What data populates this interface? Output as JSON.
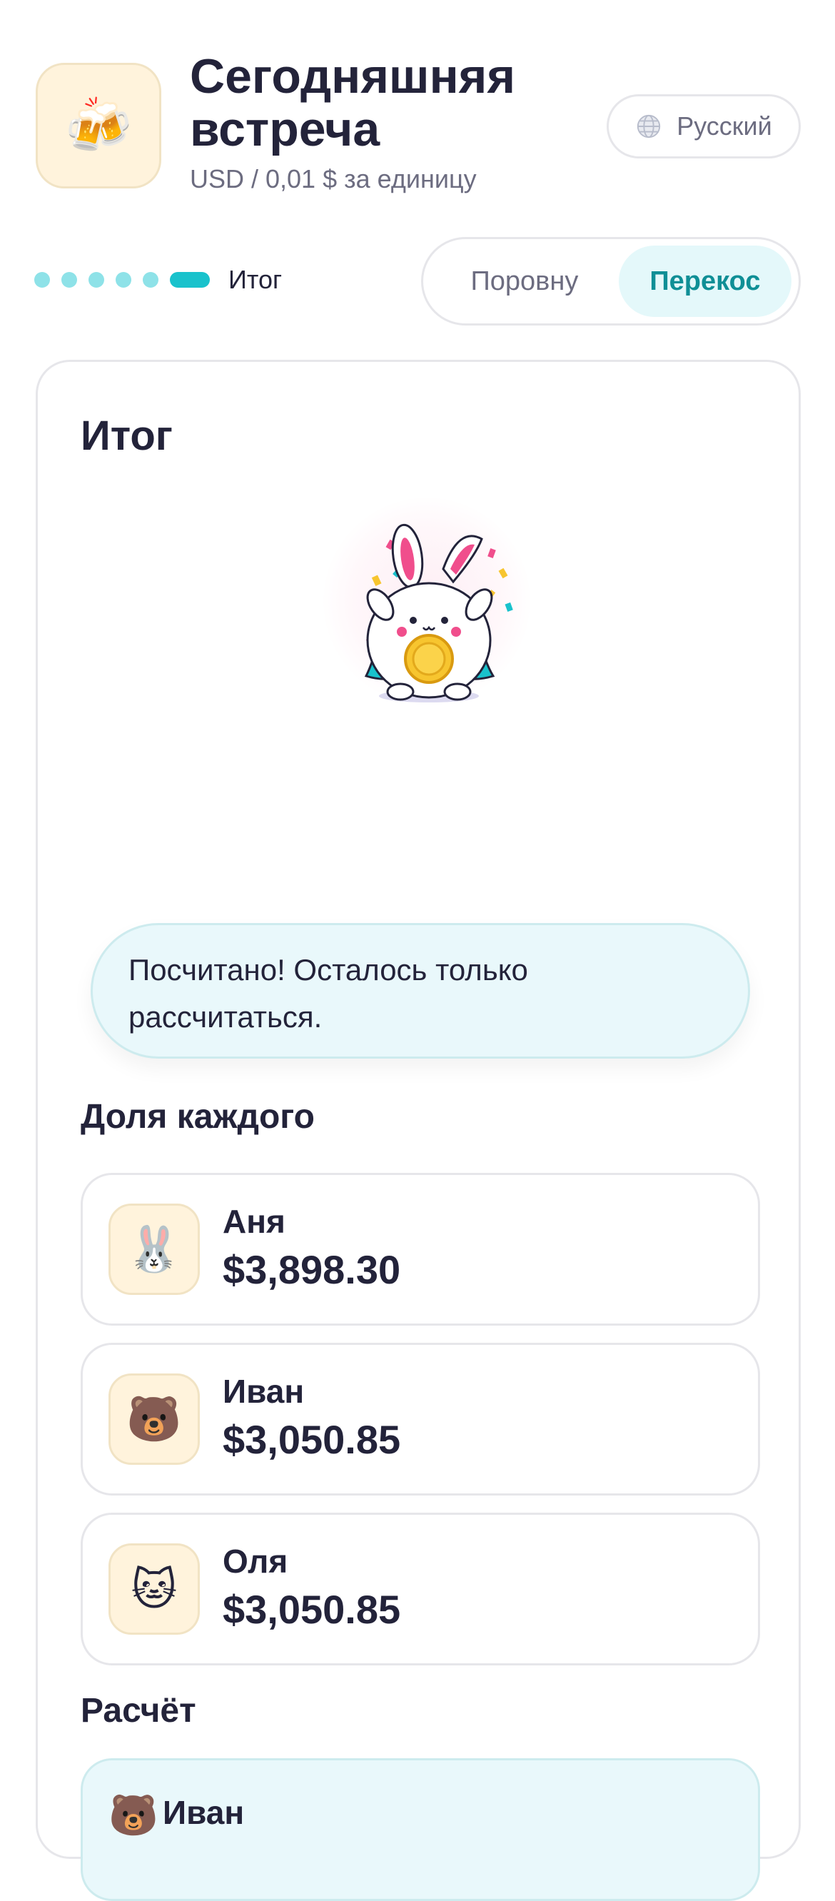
{
  "header": {
    "app_emoji": "🍻",
    "title": "Сегодняшняя встреча",
    "subtitle": "USD / 0,01 $ за единицу",
    "language": "Русский"
  },
  "progress": {
    "label": "Итог"
  },
  "mode": {
    "equal_label": "Поровну",
    "skew_label": "Перекос",
    "selected": "Перекос"
  },
  "summary": {
    "title": "Итог",
    "message": "Посчитано! Осталось только рассчитаться.",
    "shares_title": "Доля каждого",
    "shares": [
      {
        "avatar": "🐰",
        "name": "Аня",
        "amount": "$3,898.30"
      },
      {
        "avatar": "🐻",
        "name": "Иван",
        "amount": "$3,050.85"
      },
      {
        "avatar": "🐱",
        "name": "Оля",
        "amount": "$3,050.85"
      }
    ],
    "settlement_title": "Расчёт",
    "settlement_first": {
      "avatar": "🐻",
      "name": "Иван"
    }
  },
  "colors": {
    "accent": "#19c2cc",
    "accent_light": "#8ee2e8",
    "bubble_bg": "#e9f8fb",
    "avatar_bg": "#fff3dc"
  }
}
